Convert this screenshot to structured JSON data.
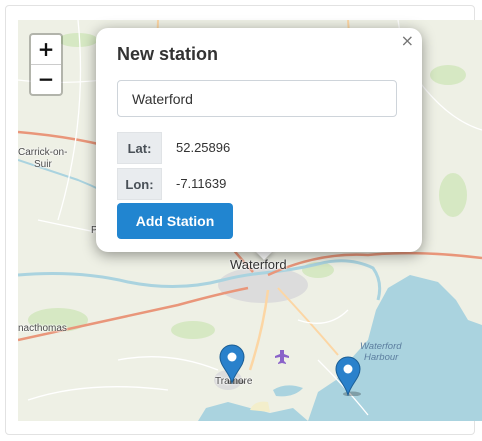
{
  "map": {
    "zoom_in_label": "+",
    "zoom_out_label": "−",
    "places": {
      "waterford": "Waterford",
      "carrick_line1": "Carrick-on-",
      "carrick_line2": "Suir",
      "mothel": "nacthomas",
      "tramore": "Tramore",
      "harbour_line1": "Waterford",
      "harbour_line2": "Harbour",
      "edge_p": "P"
    },
    "colors": {
      "sea": "#aad3df",
      "land": "#eef0e5",
      "road": "#e9967a",
      "marker": "#2a81cb"
    }
  },
  "popup": {
    "title": "New station",
    "close_label": "×",
    "name_value": "Waterford",
    "name_placeholder": "",
    "lat_label": "Lat:",
    "lat_value": "52.25896",
    "lon_label": "Lon:",
    "lon_value": "-7.11639",
    "add_button_label": "Add Station"
  }
}
